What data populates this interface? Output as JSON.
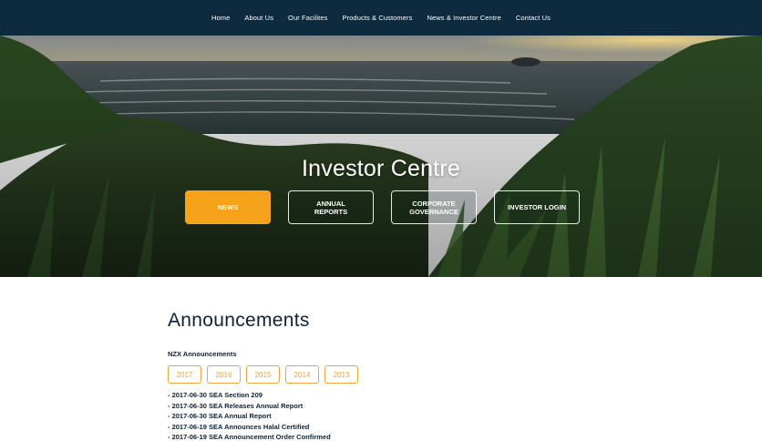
{
  "nav": {
    "items": [
      {
        "label": "Home"
      },
      {
        "label": "About Us"
      },
      {
        "label": "Our Facilites"
      },
      {
        "label": "Products & Customers"
      },
      {
        "label": "News & Investor Centre"
      },
      {
        "label": "Contact Us"
      }
    ]
  },
  "hero": {
    "title": "Investor Centre",
    "buttons": [
      {
        "label": "NEWS",
        "active": true
      },
      {
        "label": "ANNUAL\nREPORTS",
        "active": false
      },
      {
        "label": "CORPORATE\nGOVERNANCE",
        "active": false
      },
      {
        "label": "INVESTOR LOGIN",
        "active": false
      }
    ]
  },
  "main": {
    "title": "Announcements",
    "subheading": "NZX Announcements",
    "years": [
      "2017",
      "2016",
      "2015",
      "2014",
      "2013"
    ],
    "announcements": [
      "- 2017-06-30 SEA Section 209",
      "- 2017-06-30 SEA Releases Annual Report",
      "- 2017-06-30 SEA Annual Report",
      "- 2017-06-19 SEA Announces Halal Certified",
      "- 2017-06-19 SEA Announcement Order Confirmed"
    ]
  },
  "colors": {
    "nav_bg": "#0e2a3f",
    "accent": "#f7a21b",
    "text_dark": "#0f2236"
  }
}
